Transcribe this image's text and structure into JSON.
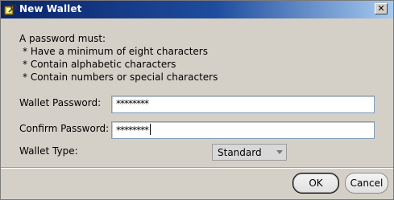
{
  "window": {
    "title": "New Wallet",
    "close_glyph": "✕",
    "title_icon": "wallet-key-icon"
  },
  "requirements": {
    "heading": "A password must:",
    "items": [
      "* Have a minimum of eight characters",
      "* Contain alphabetic characters",
      "* Contain numbers or special characters"
    ]
  },
  "form": {
    "password_label": "Wallet Password:",
    "password_value": "********",
    "confirm_label": "Confirm Password:",
    "confirm_value": "********",
    "type_label": "Wallet Type:",
    "type_selected": "Standard"
  },
  "buttons": {
    "ok": "OK",
    "cancel": "Cancel"
  },
  "colors": {
    "title_bar_start": "#0a246a",
    "title_bar_end": "#a6caf0",
    "dialog_background": "#d4d0c8"
  }
}
